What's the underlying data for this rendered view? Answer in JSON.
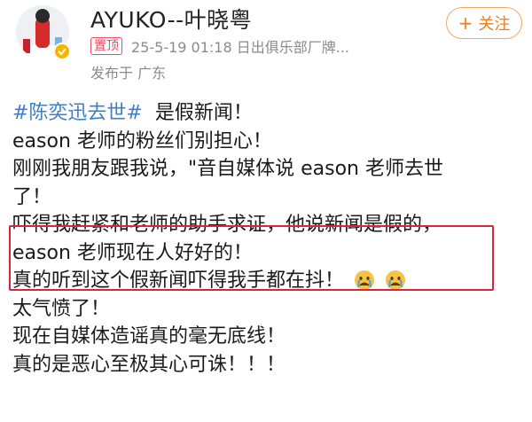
{
  "header": {
    "username": "AYUKO--叶晓粤",
    "pin_badge": "置顶",
    "meta_line": "25-5-19 01:18  日出俱乐部厂牌...",
    "location": "发布于 广东",
    "follow_label": "关注",
    "follow_icon": "plus-icon",
    "accent_color": "#f47a19"
  },
  "post": {
    "hashtag": "#陈奕迅去世#",
    "line1_rest": "是假新闻！",
    "line2": "eason 老师的粉丝们别担心！",
    "line3": "刚刚我朋友跟我说，\"音自媒体说 eason 老师去世",
    "line4": "了！",
    "line5": "吓得我赶紧和老师的助手求证，他说新闻是假的，",
    "line6": "eason 老师现在人好好的！",
    "line7": "真的听到这个假新闻吓得我手都在抖！",
    "line7_emojis": [
      "crying-face-icon",
      "crying-face-icon"
    ],
    "line8": "太气愤了！",
    "line9": "现在自媒体造谣真的毫无底线！",
    "line10": "真的是恶心至极其心可诛！！！"
  }
}
